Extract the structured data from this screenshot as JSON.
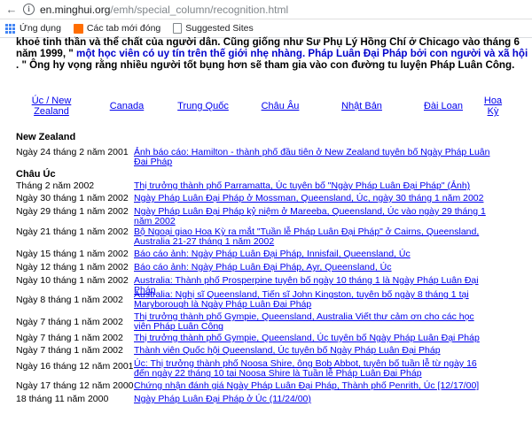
{
  "browser": {
    "url_host": "en.minghui.org",
    "url_path": "/emh/special_column/recognition.html",
    "bookmarks": [
      {
        "label": "Ứng dụng"
      },
      {
        "label": "Các tab mới đóng"
      },
      {
        "label": "Suggested Sites"
      }
    ]
  },
  "intro": {
    "text1": "khoẻ tinh thần và thể chất của người dân. Cũng giống như Sư Phụ Lý Hồng Chí ở Chicago vào tháng 6 năm 1999, \"",
    "text2": "một học viên có uy tín trên thế giới nhẹ nhàng. Pháp Luân Đại Pháp bởi con người và xã hội",
    "text3": ". \" Ông hy vọng rằng nhiều người tốt bụng hơn sẽ tham gia vào con đường tu luyện Pháp Luân Công."
  },
  "regions": [
    "Úc / New Zealand",
    "Canada",
    "Trung Quốc",
    "Châu Âu",
    "Nhật Bản",
    "Đài Loan",
    "Hoa Kỳ"
  ],
  "sections": [
    {
      "title": "New Zealand"
    },
    {
      "title": "Châu Úc"
    }
  ],
  "rows": [
    {
      "date": "Ngày 24 tháng 2 năm 2001",
      "link": "Ảnh báo cáo: Hamilton - thành phố đầu tiên ở New Zealand tuyên bố Ngày Pháp Luân Đại Pháp"
    },
    {
      "date": "Tháng 2 năm 2002",
      "link": "Thị trưởng thành phố Parramatta, Úc tuyên bố \"Ngày Pháp Luân Đại Pháp\" (Ảnh)"
    },
    {
      "date": "Ngày 30 tháng 1 năm 2002",
      "link": "Ngày Pháp Luân Đại Pháp ở Mossman, Queensland, Úc, ngày 30 tháng 1 năm 2002"
    },
    {
      "date": "Ngày 29 tháng 1 năm 2002",
      "link": "Ngày Pháp Luân Đại Pháp kỷ niệm ở Mareeba, Queensland, Úc vào ngày 29 tháng 1 năm 2002"
    },
    {
      "date": "Ngày 21 tháng 1 năm 2002",
      "link": "Bộ Ngoại giao Hoa Kỳ ra mắt \"Tuần lễ Pháp Luân Đại Pháp\" ở Cairns, Queensland, Australia 21-27 tháng 1 năm 2002"
    },
    {
      "date": "Ngày 15 tháng 1 năm 2002",
      "link": "Báo cáo ảnh: Ngày Pháp Luân Đại Pháp, Innisfail, Queensland, Úc"
    },
    {
      "date": "Ngày 12 tháng 1 năm 2002",
      "link": "Báo cáo ảnh: Ngày Pháp Luân Đại Pháp, Ayr, Queensland, Úc"
    },
    {
      "date": "Ngày 10 tháng 1 năm 2002",
      "link": "Australia: Thành phố Prosperpine tuyên bố ngày 10 tháng 1 là Ngày Pháp Luân Đại Pháp"
    },
    {
      "date": "Ngày 8 tháng 1 năm 2002",
      "link": "Australia: Nghị sĩ Queensland, Tiến sĩ John Kingston, tuyên bố ngày 8 tháng 1 tại Maryborough là Ngày Pháp Luân Đại Pháp"
    },
    {
      "date": "Ngày 7 tháng 1 năm 2002",
      "link": "Thị trưởng thành phố Gympie, Queensland, Australia Viết thư cảm ơn cho các học viên Pháp Luân Công"
    },
    {
      "date": "Ngày 7 tháng 1 năm 2002",
      "link": "Thị trưởng thành phố Gympie, Queensland, Úc tuyên bố Ngày Pháp Luân Đại Pháp"
    },
    {
      "date": "Ngày 7 tháng 1 năm 2002",
      "link": "Thành viên Quốc hội Queensland, Úc tuyên bố Ngày Pháp Luân Đại Pháp"
    },
    {
      "date": "Ngày 16 tháng 12 năm 2001",
      "link": "Úc: Thị trưởng thành phố Noosa Shire, ông Bob Abbot, tuyên bố tuần lễ từ ngày 16 đến ngày 22 tháng 10 tại Noosa Shire là Tuần lễ Pháp Luân Đại Pháp"
    },
    {
      "date": "Ngày 17 tháng 12 năm 2000",
      "link": "Chứng nhận đánh giá Ngày Pháp Luân Đại Pháp, Thành phố Penrith, Úc [12/17/00]"
    },
    {
      "date": "18 tháng 11 năm 2000",
      "link": "Ngày Pháp Luân Đại Pháp ở Úc (11/24/00)"
    }
  ]
}
